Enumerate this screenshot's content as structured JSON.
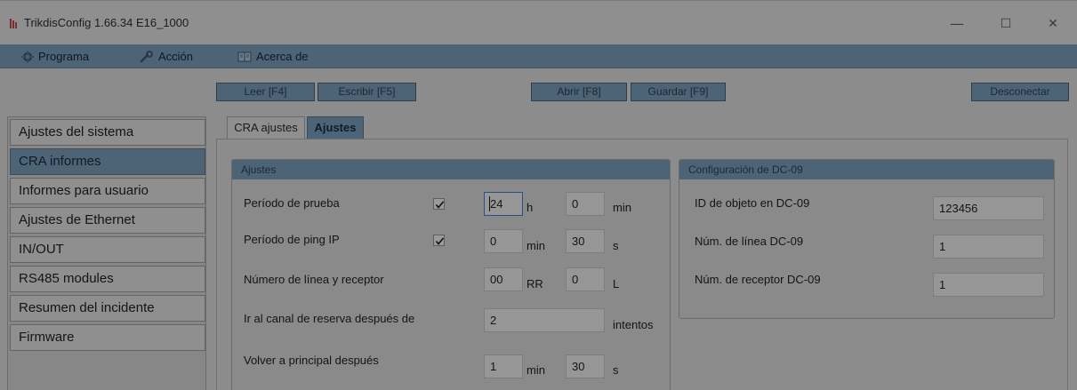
{
  "window": {
    "title": "TrikdisConfig 1.66.34   E16_1000",
    "minimize": "—",
    "maximize": "☐",
    "close": "✕"
  },
  "menu": {
    "program": "Programa",
    "action": "Acción",
    "about": "Acerca de"
  },
  "toolbar": {
    "read": "Leer [F4]",
    "write": "Escribir [F5]",
    "open": "Abrir [F8]",
    "save": "Guardar [F9]",
    "disconnect": "Desconectar"
  },
  "sidebar": {
    "items": [
      {
        "label": "Ajustes del sistema"
      },
      {
        "label": "CRA informes"
      },
      {
        "label": "Informes para usuario"
      },
      {
        "label": "Ajustes de Ethernet"
      },
      {
        "label": "IN/OUT"
      },
      {
        "label": "RS485 modules"
      },
      {
        "label": "Resumen del incidente"
      },
      {
        "label": "Firmware"
      }
    ],
    "active_index": 1
  },
  "tabs": [
    {
      "label": "CRA ajustes"
    },
    {
      "label": "Ajustes"
    }
  ],
  "ajustes": {
    "header": "Ajustes",
    "test_period": {
      "label": "Período de prueba",
      "checked": true,
      "hours": "24",
      "hours_unit": "h",
      "minutes": "0",
      "minutes_unit": "min"
    },
    "ping_period": {
      "label": "Período de ping IP",
      "checked": true,
      "minutes": "0",
      "minutes_unit": "min",
      "seconds": "30",
      "seconds_unit": "s"
    },
    "line_receiver": {
      "label": "Número de línea y receptor",
      "receiver": "00",
      "receiver_unit": "RR",
      "line": "0",
      "line_unit": "L"
    },
    "backup_channel": {
      "label": "Ir al canal de reserva después de",
      "attempts": "2",
      "attempts_unit": "intentos"
    },
    "return_primary": {
      "label": "Volver a principal después",
      "minutes": "1",
      "minutes_unit": "min",
      "seconds": "30",
      "seconds_unit": "s"
    }
  },
  "dc09": {
    "header": "Configuración de DC-09",
    "object_id": {
      "label": "ID de objeto en DC-09",
      "value": "123456"
    },
    "line_number": {
      "label": "Núm. de línea DC-09",
      "value": "1"
    },
    "receiver_number": {
      "label": "Núm. de receptor DC-09",
      "value": "1"
    }
  },
  "colors": {
    "accent": "#4d6376",
    "background": "#8c8c8c"
  }
}
